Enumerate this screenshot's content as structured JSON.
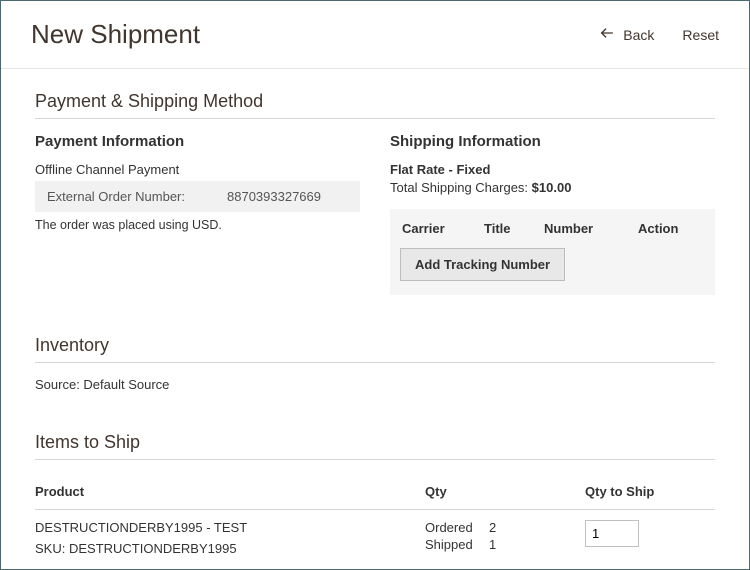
{
  "header": {
    "title": "New Shipment",
    "back_label": "Back",
    "reset_label": "Reset"
  },
  "payment_shipping": {
    "section_title": "Payment & Shipping Method",
    "payment": {
      "title": "Payment Information",
      "method": "Offline Channel Payment",
      "external_label": "External Order Number:",
      "external_value": "8870393327669",
      "currency_note": "The order was placed using USD."
    },
    "shipping": {
      "title": "Shipping Information",
      "method": "Flat Rate - Fixed",
      "charges_label": "Total Shipping Charges: ",
      "charges_value": "$10.00",
      "track_headers": {
        "carrier": "Carrier",
        "title": "Title",
        "number": "Number",
        "action": "Action"
      },
      "add_tracking_label": "Add Tracking Number"
    }
  },
  "inventory": {
    "section_title": "Inventory",
    "source_label": "Source: ",
    "source_value": "Default Source"
  },
  "items": {
    "section_title": "Items to Ship",
    "columns": {
      "product": "Product",
      "qty": "Qty",
      "qty_to_ship": "Qty to Ship"
    },
    "rows": [
      {
        "name": "DESTRUCTIONDERBY1995 - TEST",
        "sku_label": "SKU: ",
        "sku": "DESTRUCTIONDERBY1995",
        "ordered_label": "Ordered",
        "ordered": "2",
        "shipped_label": "Shipped",
        "shipped": "1",
        "qty_to_ship": "1"
      }
    ]
  }
}
